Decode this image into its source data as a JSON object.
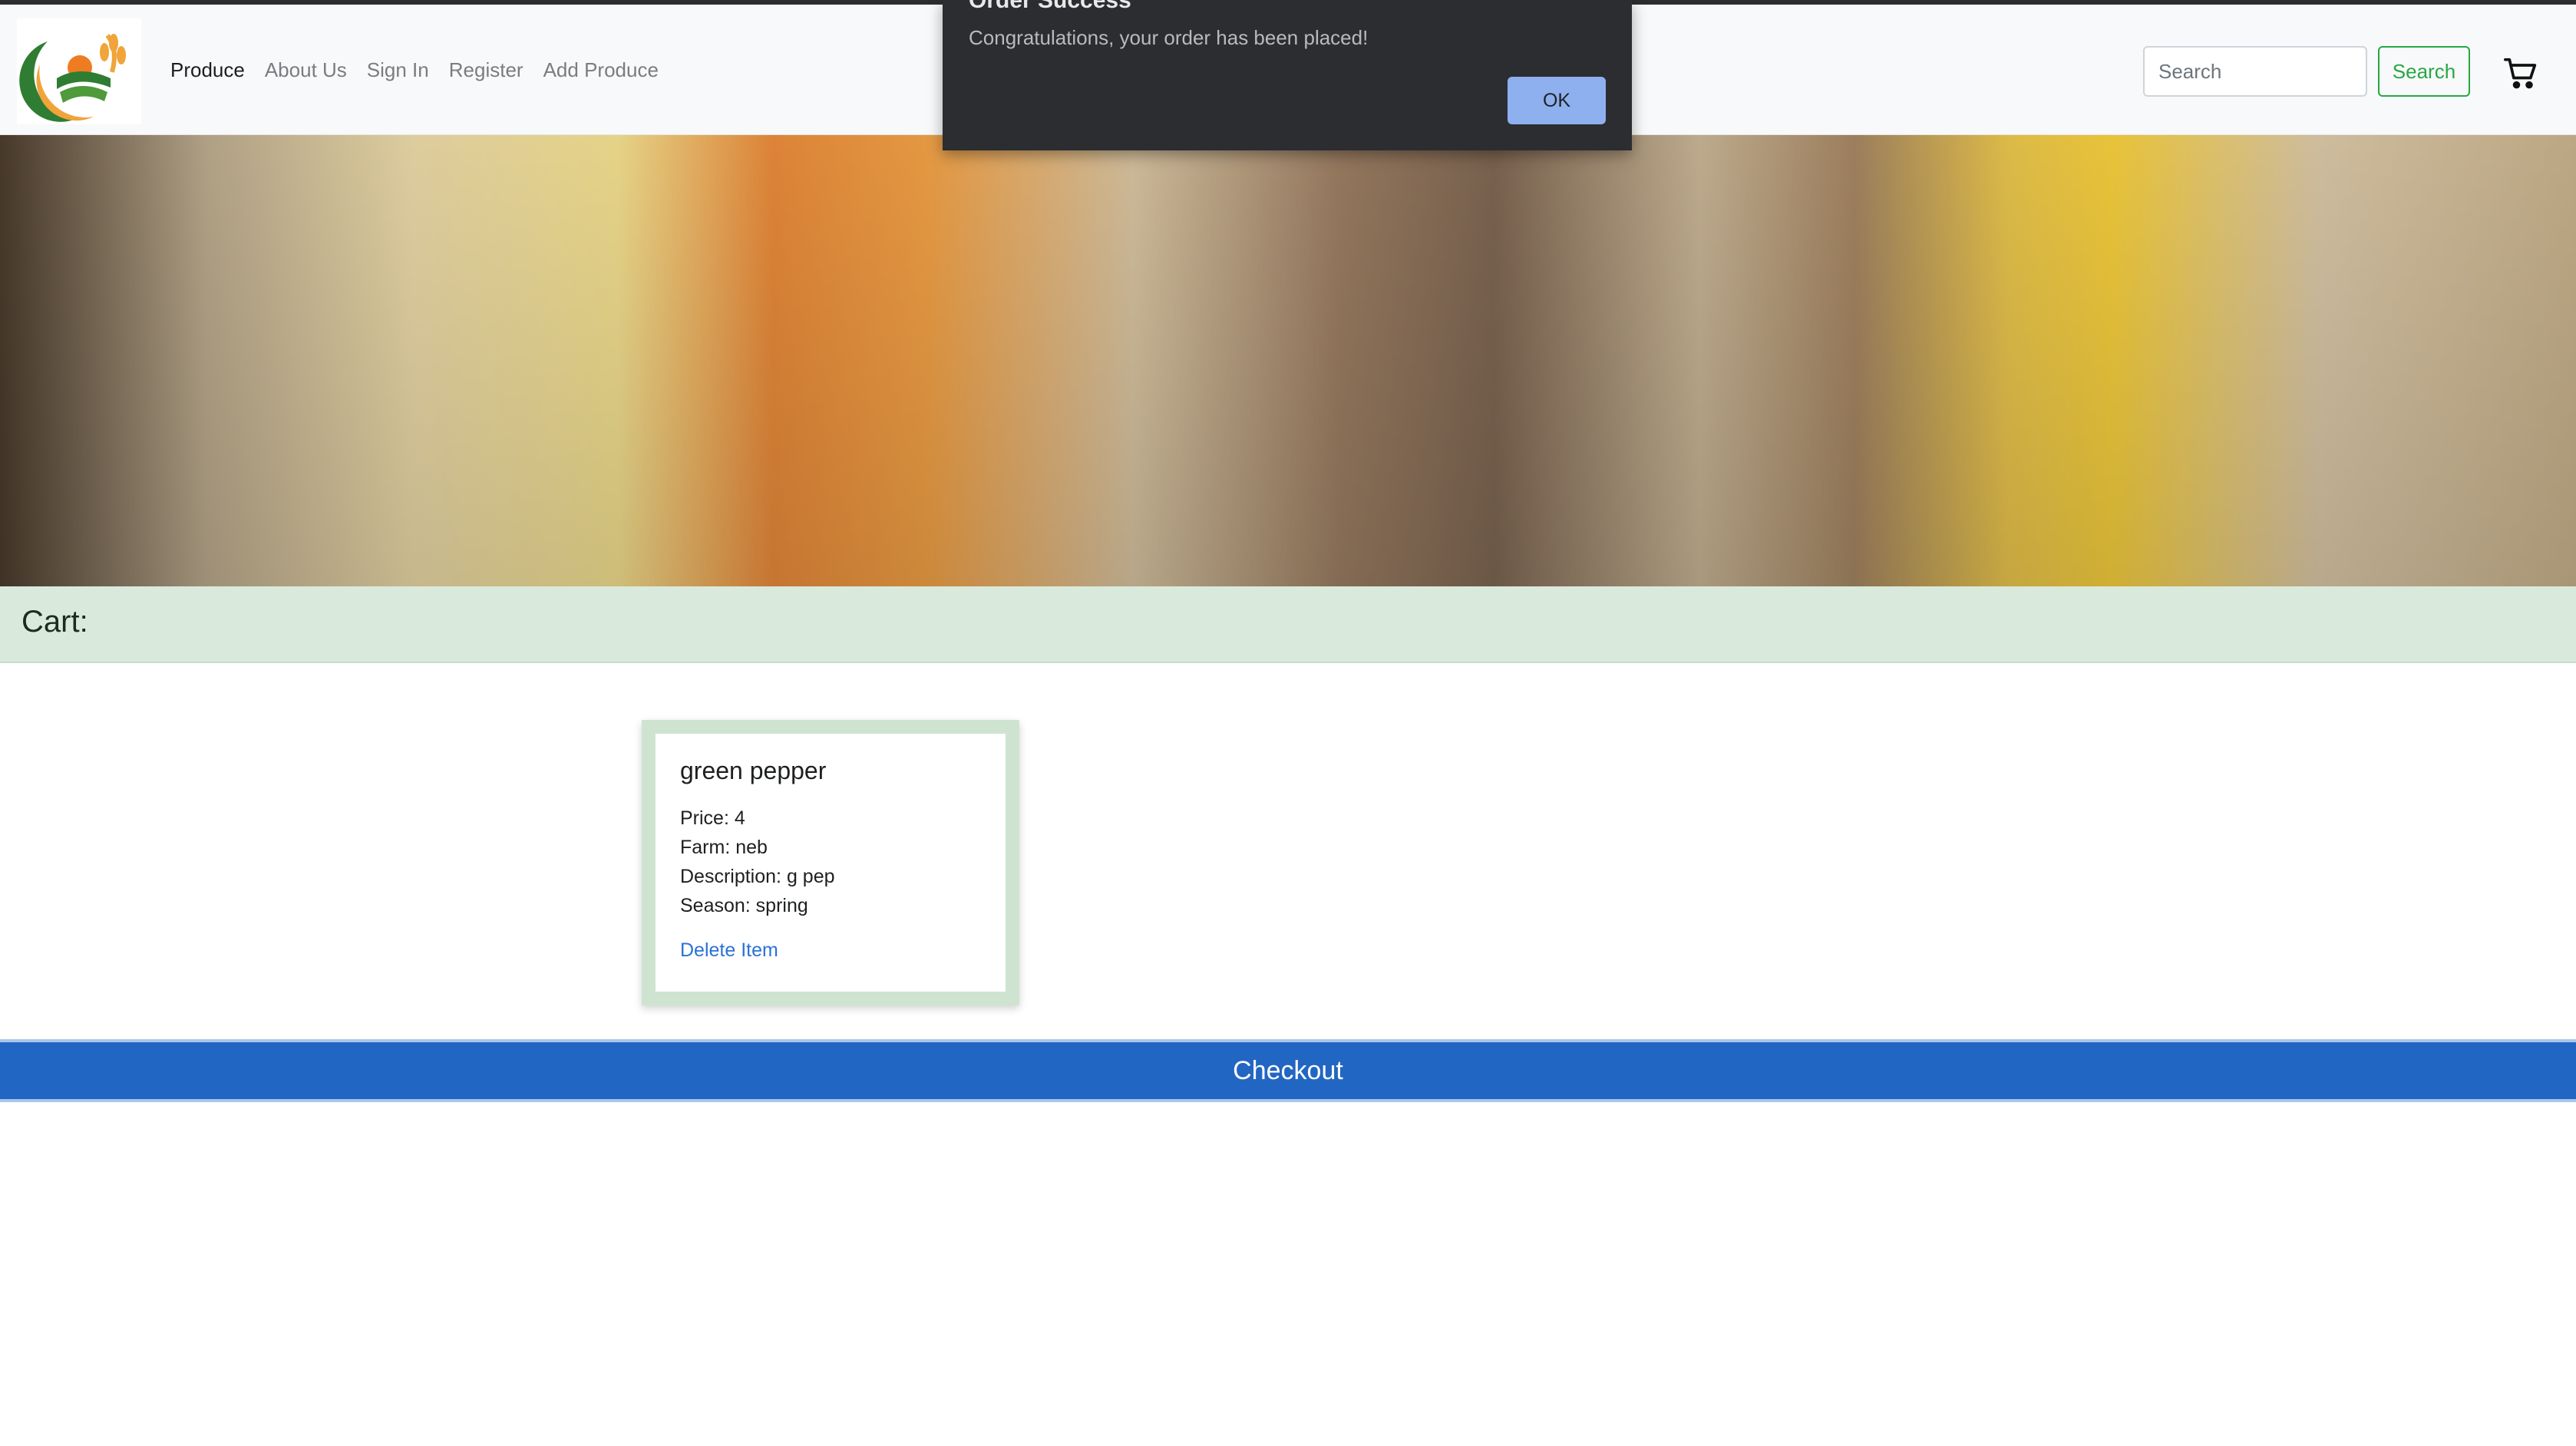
{
  "navbar": {
    "links": [
      {
        "label": "Produce",
        "active": true
      },
      {
        "label": "About Us",
        "active": false
      },
      {
        "label": "Sign In",
        "active": false
      },
      {
        "label": "Register",
        "active": false
      },
      {
        "label": "Add Produce",
        "active": false
      }
    ],
    "search": {
      "placeholder": "Search",
      "value": ""
    },
    "search_button_label": "Search",
    "cart_icon": "shopping-cart-icon"
  },
  "hero": {
    "image": "grains-and-legumes-banner"
  },
  "cart": {
    "heading": "Cart:",
    "items": [
      {
        "name": "green pepper",
        "price": "Price: 4",
        "farm": "Farm: neb",
        "description": "Description: g pep",
        "season": "Season: spring",
        "delete_label": "Delete Item"
      }
    ],
    "checkout_label": "Checkout"
  },
  "modal": {
    "title": "Order Success",
    "message": "Congratulations, your order has been placed!",
    "ok_label": "OK"
  },
  "colors": {
    "navbar_bg": "#f8f9fa",
    "cart_bar_bg": "#d9eadc",
    "checkout_bg": "#2266c4",
    "search_button": "#28a745",
    "link": "#2a72d6",
    "modal_bg": "#2b2d31",
    "modal_button": "#8fb0ee"
  }
}
